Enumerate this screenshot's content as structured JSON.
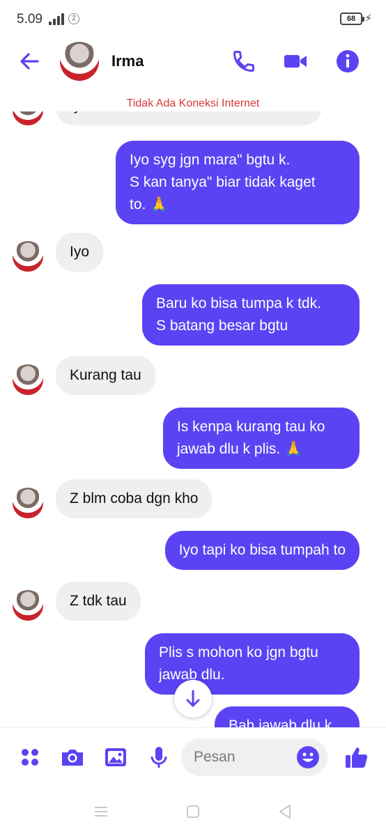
{
  "status_bar": {
    "time": "5.09",
    "sim_indicator": "2",
    "battery": "68",
    "icons": [
      "signal-icon",
      "battery-icon",
      "charging-icon"
    ]
  },
  "header": {
    "contact_name": "Irma",
    "icons": [
      "back-arrow-icon",
      "phone-icon",
      "video-camera-icon",
      "info-icon"
    ]
  },
  "connection_warning": "Tidak Ada Koneksi Internet",
  "messages": [
    {
      "from": "contact",
      "lines": [
        "Iyo"
      ]
    },
    {
      "from": "me",
      "lines": [
        "Iyo syg jgn mara\" bgtu k.",
        "S kan tanya\" biar tidak kaget",
        "to. 🙏"
      ]
    },
    {
      "from": "contact",
      "lines": [
        "Iyo"
      ]
    },
    {
      "from": "me",
      "lines": [
        "Baru ko bisa tumpa k tdk.",
        "S batang besar bgtu"
      ]
    },
    {
      "from": "contact",
      "lines": [
        "Kurang tau"
      ]
    },
    {
      "from": "me",
      "lines": [
        "Is kenpa kurang tau ko",
        "jawab dlu k plis. 🙏"
      ]
    },
    {
      "from": "contact",
      "lines": [
        "Z blm coba dgn kho"
      ]
    },
    {
      "from": "me",
      "lines": [
        "Iyo tapi ko bisa tumpah to"
      ]
    },
    {
      "from": "contact",
      "lines": [
        "Z tdk tau"
      ]
    },
    {
      "from": "me",
      "lines": [
        "Plis s mohon ko jgn bgtu",
        "jawab dlu."
      ]
    },
    {
      "from": "me",
      "lines": [
        "Bah jawab dlu k"
      ]
    }
  ],
  "composer": {
    "placeholder": "Pesan",
    "icons": [
      "apps-grid-icon",
      "camera-icon",
      "image-icon",
      "microphone-icon",
      "emoji-icon",
      "thumbs-up-icon"
    ]
  },
  "navigation": {
    "icons": [
      "menu-icon",
      "home-icon",
      "back-icon"
    ]
  },
  "colors": {
    "accent": "#5b43f3",
    "incoming_bubble": "#efefef",
    "warning": "#d93838"
  }
}
